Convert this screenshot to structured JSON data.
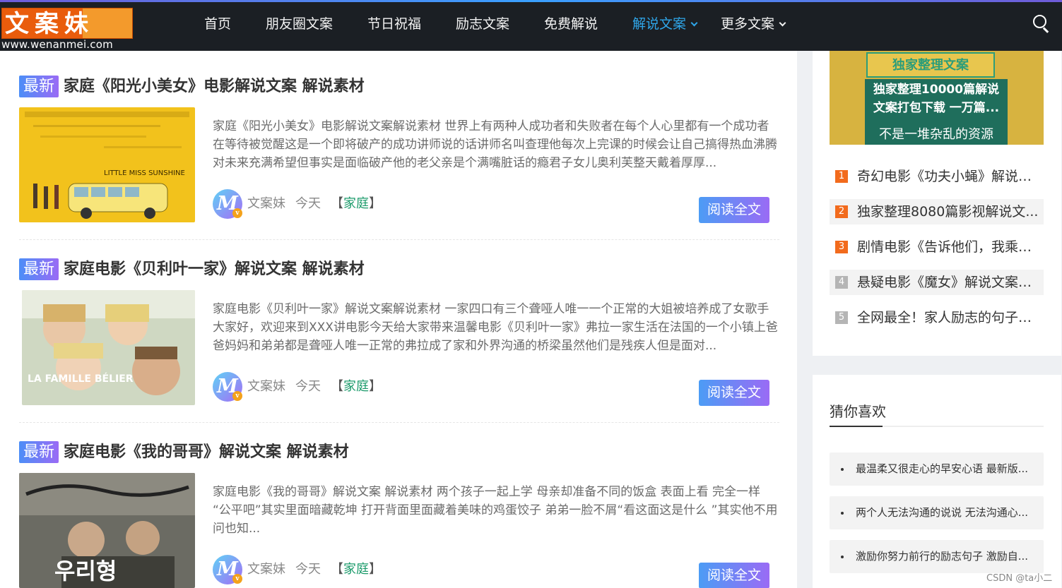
{
  "logo": {
    "text": "文案妹",
    "url": "www.wenanmei.com"
  },
  "nav": {
    "items": [
      {
        "label": "首页"
      },
      {
        "label": "朋友圈文案"
      },
      {
        "label": "节日祝福"
      },
      {
        "label": "励志文案"
      },
      {
        "label": "免费解说"
      },
      {
        "label": "解说文案"
      },
      {
        "label": "更多文案"
      }
    ]
  },
  "posts": [
    {
      "badge": "最新",
      "title": "家庭《阳光小美女》电影解说文案 解说素材",
      "excerpt": "家庭《阳光小美女》电影解说文案解说素材 世界上有两种人成功者和失败者在每个人心里都有一个成功者在等待被觉醒这是一个即将破产的成功讲师说的话讲师名叫查理他每次上完课的时候会让自己搞得热血沸腾对未来充满希望但事实是面临破产他的老父亲是个满嘴脏话的瘾君子女儿奥利芙整天戴着厚厚...",
      "poster_text": "LITTLE MISS SUNSHINE",
      "author": "文案妹",
      "time": "今天",
      "bracket_open": "【",
      "category": "家庭",
      "bracket_close": "】",
      "read_label": "阅读全文"
    },
    {
      "badge": "最新",
      "title": "家庭电影《贝利叶一家》解说文案 解说素材",
      "excerpt": "家庭电影《贝利叶一家》解说文案解说素材 一家四口有三个聋哑人唯一一个正常的大姐被培养成了女歌手大家好，欢迎来到XXX讲电影今天给大家带来温馨电影《贝利叶一家》弗拉一家生活在法国的一个小镇上爸爸妈妈和弟弟都是聋哑人唯一正常的弗拉成了家和外界沟通的桥梁虽然他们是残疾人但是面对...",
      "poster_text": "LA FAMILLE BÉLIER",
      "author": "文案妹",
      "time": "今天",
      "bracket_open": "【",
      "category": "家庭",
      "bracket_close": "】",
      "read_label": "阅读全文"
    },
    {
      "badge": "最新",
      "title": "家庭电影《我的哥哥》解说文案 解说素材",
      "excerpt": "家庭电影《我的哥哥》解说文案 解说素材 两个孩子一起上学 母亲却准备不同的饭盒 表面上看 完全一样 “公平吧”其实里面暗藏乾坤 打开背面里面藏着美味的鸡蛋饺子 弟弟一脸不屑“看这面这是什么 ”其实他不用问也知...",
      "poster_text": "우리형",
      "author": "文案妹",
      "time": "今天",
      "bracket_open": "【",
      "category": "家庭",
      "bracket_close": "】",
      "read_label": "阅读全文"
    }
  ],
  "sidebar": {
    "ad": {
      "top_text": "独家整理文案",
      "line1": "独家整理10000篇解说",
      "line2": "文案打包下载 一万篇...",
      "bottom_text": "不是一堆杂乱的资源"
    },
    "hot": [
      {
        "num": "1",
        "text": "奇幻电影《功夫小蝇》解说文...",
        "color": "#f26b1d"
      },
      {
        "num": "2",
        "text": "独家整理8080篇影视解说文...",
        "color": "#f26b1d"
      },
      {
        "num": "3",
        "text": "剧情电影《告诉他们，我乘白...",
        "color": "#f26b1d"
      },
      {
        "num": "4",
        "text": "悬疑电影《魔女》解说文案完...",
        "color": "#b5b5b5"
      },
      {
        "num": "5",
        "text": "全网最全！家人励志的句子精...",
        "color": "#b5b5b5"
      }
    ],
    "guess": {
      "title": "猜你喜欢",
      "items": [
        {
          "text": "最温柔又很走心的早安心语 最新版..."
        },
        {
          "text": "两个人无法沟通的说说 无法沟通心..."
        },
        {
          "text": "激励你努力前行的励志句子 激励自..."
        }
      ]
    }
  },
  "watermark": "CSDN @ta小二",
  "colors": {
    "accent": "#2fa6e9",
    "header_bg": "#1b1f24",
    "category": "#1a9a6a"
  }
}
